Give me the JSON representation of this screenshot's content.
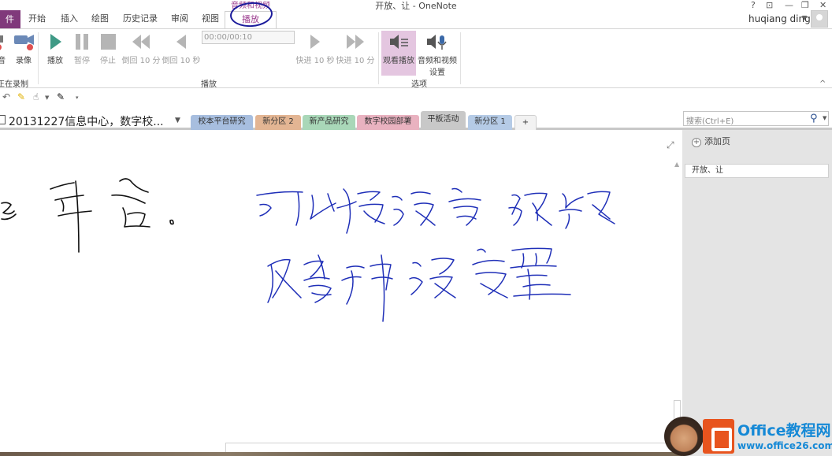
{
  "window": {
    "title": "开放、让 - OneNote",
    "user": "huqiang ding",
    "controls": [
      "?",
      "⊡",
      "—",
      "❐",
      "✕"
    ]
  },
  "ribbon_tabs": {
    "file": "件",
    "home": "开始",
    "insert": "插入",
    "draw": "绘图",
    "history": "历史记录",
    "review": "审阅",
    "view": "视图",
    "context_group": "音频和视频",
    "context_tab": "播放"
  },
  "ribbon": {
    "record_audio": "音",
    "record_video": "录像",
    "recording_label": "正在录制",
    "play": "播放",
    "pause": "暂停",
    "stop": "停止",
    "rewind10m": "倒回 10 分",
    "rewind10s": "倒回 10 秒",
    "time": "00:00/00:10",
    "ff10s": "快进 10 秒",
    "ff10m": "快进 10 分",
    "playback_group": "播放",
    "see_playback": "观看播放",
    "av_settings_line1": "音频和视频",
    "av_settings_line2": "设置",
    "options_group": "选项"
  },
  "notebook": {
    "name": "20131227信息中心，数字校..."
  },
  "sections": [
    {
      "label": "校本平台研究",
      "color": "#a7bedf"
    },
    {
      "label": "新分区 2",
      "color": "#e3b593"
    },
    {
      "label": "新产品研究",
      "color": "#a9d7b8"
    },
    {
      "label": "数字校园部署",
      "color": "#e9b2c0"
    },
    {
      "label": "平板活动",
      "color": "#c8c8c8"
    },
    {
      "label": "新分区 1",
      "color": "#b5cbe6"
    },
    {
      "label": "+",
      "color": "#f2f2f2"
    }
  ],
  "search": {
    "placeholder": "搜索(Ctrl+E)"
  },
  "pages": {
    "add": "添加页",
    "items": [
      "开放、让"
    ]
  },
  "ink_strokes_color": "#1f2fb8",
  "watermark": {
    "line1": "Office教程网",
    "line2": "www.office26.com"
  }
}
